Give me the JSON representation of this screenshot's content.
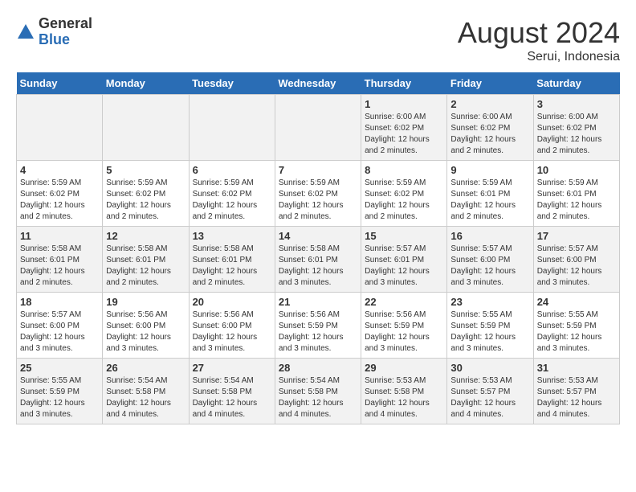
{
  "logo": {
    "general": "General",
    "blue": "Blue"
  },
  "title": "August 2024",
  "location": "Serui, Indonesia",
  "days_of_week": [
    "Sunday",
    "Monday",
    "Tuesday",
    "Wednesday",
    "Thursday",
    "Friday",
    "Saturday"
  ],
  "weeks": [
    [
      {
        "day": "",
        "info": ""
      },
      {
        "day": "",
        "info": ""
      },
      {
        "day": "",
        "info": ""
      },
      {
        "day": "",
        "info": ""
      },
      {
        "day": "1",
        "info": "Sunrise: 6:00 AM\nSunset: 6:02 PM\nDaylight: 12 hours\nand 2 minutes."
      },
      {
        "day": "2",
        "info": "Sunrise: 6:00 AM\nSunset: 6:02 PM\nDaylight: 12 hours\nand 2 minutes."
      },
      {
        "day": "3",
        "info": "Sunrise: 6:00 AM\nSunset: 6:02 PM\nDaylight: 12 hours\nand 2 minutes."
      }
    ],
    [
      {
        "day": "4",
        "info": "Sunrise: 5:59 AM\nSunset: 6:02 PM\nDaylight: 12 hours\nand 2 minutes."
      },
      {
        "day": "5",
        "info": "Sunrise: 5:59 AM\nSunset: 6:02 PM\nDaylight: 12 hours\nand 2 minutes."
      },
      {
        "day": "6",
        "info": "Sunrise: 5:59 AM\nSunset: 6:02 PM\nDaylight: 12 hours\nand 2 minutes."
      },
      {
        "day": "7",
        "info": "Sunrise: 5:59 AM\nSunset: 6:02 PM\nDaylight: 12 hours\nand 2 minutes."
      },
      {
        "day": "8",
        "info": "Sunrise: 5:59 AM\nSunset: 6:02 PM\nDaylight: 12 hours\nand 2 minutes."
      },
      {
        "day": "9",
        "info": "Sunrise: 5:59 AM\nSunset: 6:01 PM\nDaylight: 12 hours\nand 2 minutes."
      },
      {
        "day": "10",
        "info": "Sunrise: 5:59 AM\nSunset: 6:01 PM\nDaylight: 12 hours\nand 2 minutes."
      }
    ],
    [
      {
        "day": "11",
        "info": "Sunrise: 5:58 AM\nSunset: 6:01 PM\nDaylight: 12 hours\nand 2 minutes."
      },
      {
        "day": "12",
        "info": "Sunrise: 5:58 AM\nSunset: 6:01 PM\nDaylight: 12 hours\nand 2 minutes."
      },
      {
        "day": "13",
        "info": "Sunrise: 5:58 AM\nSunset: 6:01 PM\nDaylight: 12 hours\nand 2 minutes."
      },
      {
        "day": "14",
        "info": "Sunrise: 5:58 AM\nSunset: 6:01 PM\nDaylight: 12 hours\nand 3 minutes."
      },
      {
        "day": "15",
        "info": "Sunrise: 5:57 AM\nSunset: 6:01 PM\nDaylight: 12 hours\nand 3 minutes."
      },
      {
        "day": "16",
        "info": "Sunrise: 5:57 AM\nSunset: 6:00 PM\nDaylight: 12 hours\nand 3 minutes."
      },
      {
        "day": "17",
        "info": "Sunrise: 5:57 AM\nSunset: 6:00 PM\nDaylight: 12 hours\nand 3 minutes."
      }
    ],
    [
      {
        "day": "18",
        "info": "Sunrise: 5:57 AM\nSunset: 6:00 PM\nDaylight: 12 hours\nand 3 minutes."
      },
      {
        "day": "19",
        "info": "Sunrise: 5:56 AM\nSunset: 6:00 PM\nDaylight: 12 hours\nand 3 minutes."
      },
      {
        "day": "20",
        "info": "Sunrise: 5:56 AM\nSunset: 6:00 PM\nDaylight: 12 hours\nand 3 minutes."
      },
      {
        "day": "21",
        "info": "Sunrise: 5:56 AM\nSunset: 5:59 PM\nDaylight: 12 hours\nand 3 minutes."
      },
      {
        "day": "22",
        "info": "Sunrise: 5:56 AM\nSunset: 5:59 PM\nDaylight: 12 hours\nand 3 minutes."
      },
      {
        "day": "23",
        "info": "Sunrise: 5:55 AM\nSunset: 5:59 PM\nDaylight: 12 hours\nand 3 minutes."
      },
      {
        "day": "24",
        "info": "Sunrise: 5:55 AM\nSunset: 5:59 PM\nDaylight: 12 hours\nand 3 minutes."
      }
    ],
    [
      {
        "day": "25",
        "info": "Sunrise: 5:55 AM\nSunset: 5:59 PM\nDaylight: 12 hours\nand 3 minutes."
      },
      {
        "day": "26",
        "info": "Sunrise: 5:54 AM\nSunset: 5:58 PM\nDaylight: 12 hours\nand 4 minutes."
      },
      {
        "day": "27",
        "info": "Sunrise: 5:54 AM\nSunset: 5:58 PM\nDaylight: 12 hours\nand 4 minutes."
      },
      {
        "day": "28",
        "info": "Sunrise: 5:54 AM\nSunset: 5:58 PM\nDaylight: 12 hours\nand 4 minutes."
      },
      {
        "day": "29",
        "info": "Sunrise: 5:53 AM\nSunset: 5:58 PM\nDaylight: 12 hours\nand 4 minutes."
      },
      {
        "day": "30",
        "info": "Sunrise: 5:53 AM\nSunset: 5:57 PM\nDaylight: 12 hours\nand 4 minutes."
      },
      {
        "day": "31",
        "info": "Sunrise: 5:53 AM\nSunset: 5:57 PM\nDaylight: 12 hours\nand 4 minutes."
      }
    ]
  ]
}
